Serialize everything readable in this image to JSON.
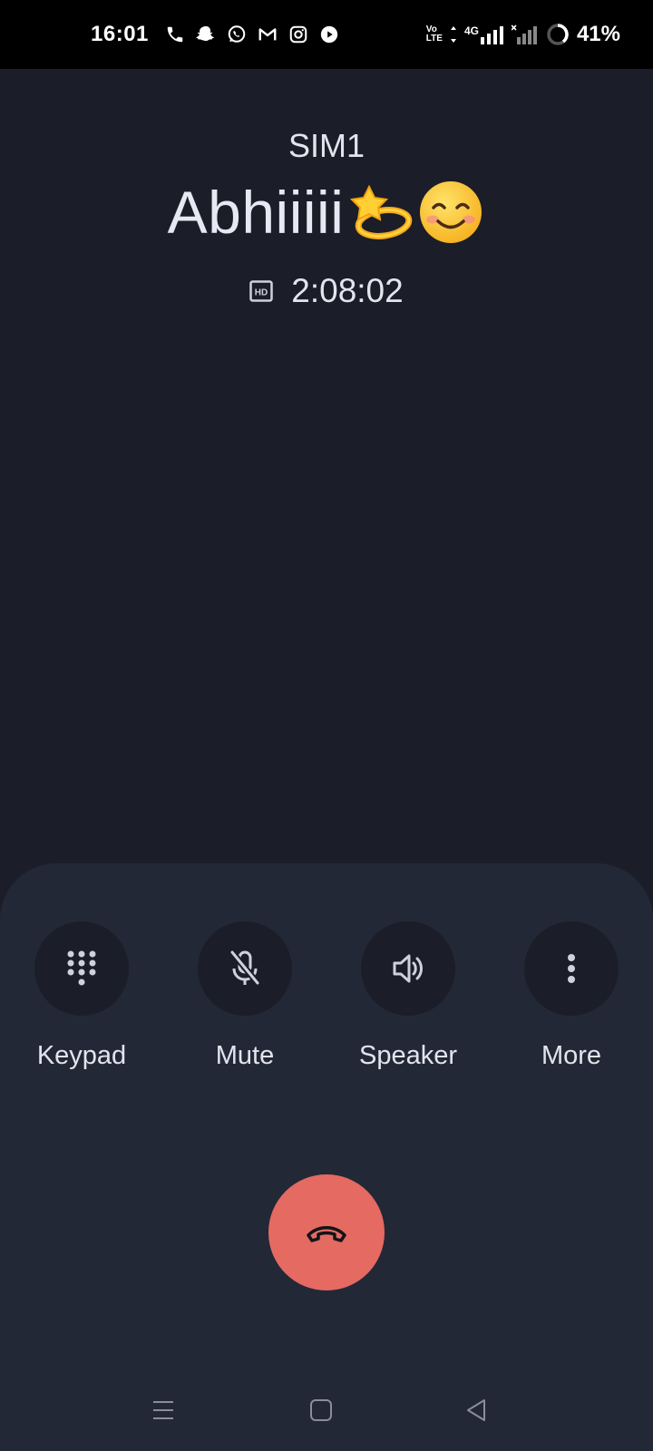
{
  "status_bar": {
    "time": "16:01",
    "notification_icons": [
      "phone-icon",
      "snapchat-icon",
      "whatsapp-icon",
      "gmail-icon",
      "instagram-icon",
      "youtube-icon"
    ],
    "volte_top": "Vo",
    "volte_bottom": "LTE",
    "network_type": "4G",
    "battery_percent": "41%"
  },
  "call": {
    "sim": "SIM1",
    "caller_name": "Abhiiiii",
    "caller_emojis": [
      "dizzy-emoji",
      "smiling-face-emoji"
    ],
    "hd_badge": "HD",
    "duration": "2:08:02"
  },
  "actions": [
    {
      "label": "Keypad",
      "icon": "keypad-icon"
    },
    {
      "label": "Mute",
      "icon": "mic-off-icon"
    },
    {
      "label": "Speaker",
      "icon": "speaker-icon"
    },
    {
      "label": "More",
      "icon": "more-vertical-icon"
    }
  ],
  "end_call": {
    "icon": "end-call-icon"
  },
  "nav_bar": {
    "buttons": [
      "menu-icon",
      "home-icon",
      "back-icon"
    ]
  },
  "colors": {
    "background": "#1b1e28",
    "sheet": "#232836",
    "end_call": "#e46a62",
    "text": "#e2e4ee"
  }
}
